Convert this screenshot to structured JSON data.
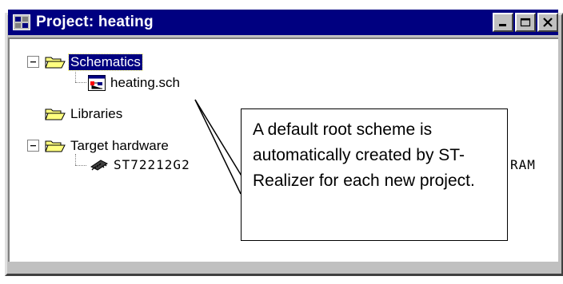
{
  "window": {
    "title": "Project: heating",
    "icon": "project-icon",
    "buttons": [
      "minimize-icon",
      "maximize-icon",
      "close-icon"
    ]
  },
  "tree": {
    "schematics": {
      "label": "Schematics",
      "expanded": true,
      "selected": true
    },
    "schematic_file": {
      "label": "heating.sch"
    },
    "libraries": {
      "label": "Libraries"
    },
    "target_hardware": {
      "label": "Target hardware",
      "expanded": true
    },
    "device": {
      "label": "ST72212G2",
      "partial_suffix": "RAM"
    }
  },
  "callout": {
    "text": "A default root scheme is automatically created by ST-Realizer for each new project."
  },
  "colors": {
    "titlebar": "#000080",
    "chrome": "#c0c0c0",
    "folder": "#ffff80",
    "selection": "#000080"
  }
}
